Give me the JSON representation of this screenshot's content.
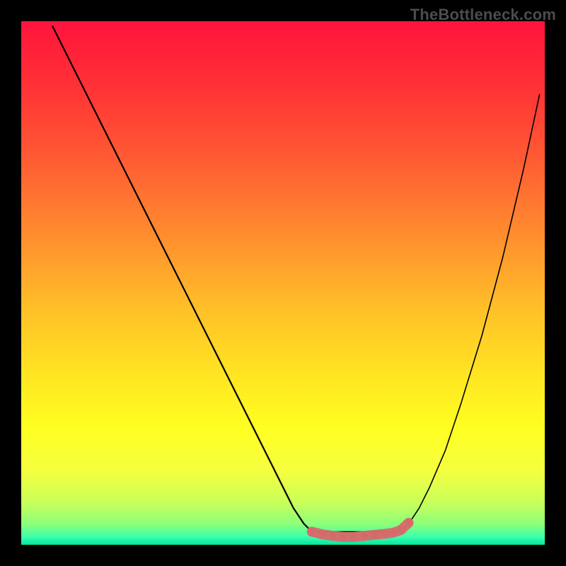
{
  "watermark": "TheBottleneck.com",
  "chart_data": {
    "type": "line",
    "title": "",
    "xlabel": "",
    "ylabel": "",
    "xlim": [
      0,
      100
    ],
    "ylim": [
      0,
      100
    ],
    "gradient_stops": [
      {
        "offset": 0.0,
        "color": "#ff143c"
      },
      {
        "offset": 0.12,
        "color": "#ff3036"
      },
      {
        "offset": 0.26,
        "color": "#ff5a33"
      },
      {
        "offset": 0.4,
        "color": "#ff8a2f"
      },
      {
        "offset": 0.55,
        "color": "#ffc028"
      },
      {
        "offset": 0.68,
        "color": "#ffe622"
      },
      {
        "offset": 0.78,
        "color": "#ffff22"
      },
      {
        "offset": 0.86,
        "color": "#f4ff40"
      },
      {
        "offset": 0.92,
        "color": "#c8ff5a"
      },
      {
        "offset": 0.96,
        "color": "#8dff7a"
      },
      {
        "offset": 0.985,
        "color": "#3dffac"
      },
      {
        "offset": 1.0,
        "color": "#00e6a0"
      }
    ],
    "series": [
      {
        "name": "left-branch",
        "x": [
          6,
          10,
          15,
          20,
          25,
          30,
          35,
          40,
          45,
          50,
          52,
          54,
          55.5
        ],
        "y": [
          99,
          91,
          81,
          71,
          61,
          51,
          41,
          31,
          21,
          11,
          7,
          4,
          2.5
        ]
      },
      {
        "name": "right-branch",
        "x": [
          72.5,
          74,
          76,
          78,
          81,
          84,
          88,
          92,
          96,
          99
        ],
        "y": [
          2.5,
          4,
          7,
          11,
          18,
          27,
          40,
          55,
          72,
          86
        ]
      }
    ],
    "flat_segment": {
      "x": [
        55.5,
        72.5
      ],
      "y": [
        2.5,
        2.5
      ]
    },
    "markers": {
      "color": "#d66a6a",
      "points": [
        {
          "x": 55.5,
          "y": 2.5,
          "r": 6
        },
        {
          "x": 57.5,
          "y": 2.0,
          "r": 5
        },
        {
          "x": 59.5,
          "y": 1.7,
          "r": 5
        },
        {
          "x": 61.5,
          "y": 1.5,
          "r": 5
        },
        {
          "x": 63.5,
          "y": 1.5,
          "r": 5
        },
        {
          "x": 65.5,
          "y": 1.7,
          "r": 5
        },
        {
          "x": 67.5,
          "y": 1.9,
          "r": 5
        },
        {
          "x": 69.5,
          "y": 2.1,
          "r": 5
        },
        {
          "x": 71.0,
          "y": 2.3,
          "r": 5
        },
        {
          "x": 72.5,
          "y": 2.8,
          "r": 6
        },
        {
          "x": 74.0,
          "y": 4.2,
          "r": 5
        }
      ]
    }
  }
}
